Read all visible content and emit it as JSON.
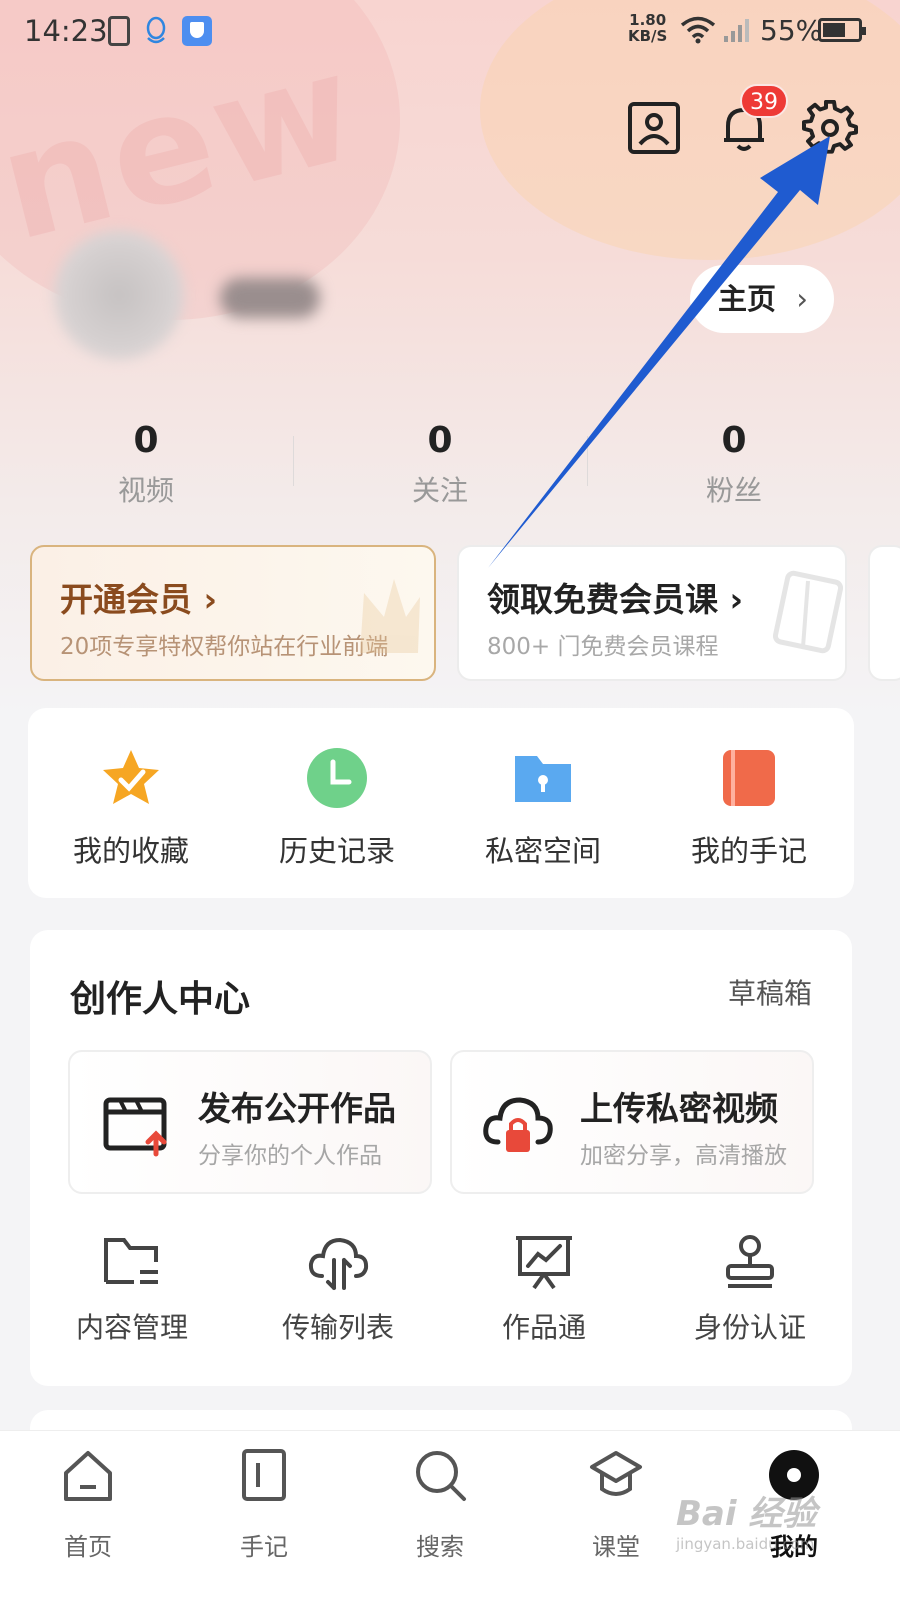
{
  "status_bar": {
    "time": "14:23",
    "net_speed_value": "1.80",
    "net_speed_unit": "KB/S",
    "battery": "55%"
  },
  "header": {
    "notification_count": "39"
  },
  "profile": {
    "homepage_label": "主页",
    "homepage_chevron": "›"
  },
  "stats": [
    {
      "value": "0",
      "label": "视频"
    },
    {
      "value": "0",
      "label": "关注"
    },
    {
      "value": "0",
      "label": "粉丝"
    }
  ],
  "promos": {
    "vip": {
      "title": "开通会员 ›",
      "subtitle": "20项专享特权帮你站在行业前端"
    },
    "course": {
      "title": "领取免费会员课 ›",
      "subtitle": "800+ 门免费会员课程"
    }
  },
  "quick_actions": [
    {
      "label": "我的收藏",
      "icon": "star-icon"
    },
    {
      "label": "历史记录",
      "icon": "clock-icon"
    },
    {
      "label": "私密空间",
      "icon": "private-folder-icon"
    },
    {
      "label": "我的手记",
      "icon": "notebook-icon"
    }
  ],
  "creator_center": {
    "title": "创作人中心",
    "drafts_label": "草稿箱",
    "publish": {
      "title": "发布公开作品",
      "subtitle": "分享你的个人作品"
    },
    "upload": {
      "title": "上传私密视频",
      "subtitle": "加密分享，高清播放"
    },
    "tools": [
      {
        "label": "内容管理",
        "icon": "folder-manage-icon"
      },
      {
        "label": "传输列表",
        "icon": "cloud-transfer-icon"
      },
      {
        "label": "作品通",
        "icon": "presentation-chart-icon"
      },
      {
        "label": "身份认证",
        "icon": "stamp-icon"
      }
    ]
  },
  "bottom_nav": [
    {
      "label": "首页",
      "icon": "home-icon"
    },
    {
      "label": "手记",
      "icon": "notes-icon"
    },
    {
      "label": "搜索",
      "icon": "search-icon"
    },
    {
      "label": "课堂",
      "icon": "classroom-icon"
    },
    {
      "label": "我的",
      "icon": "profile-dot-icon",
      "active": true
    }
  ],
  "watermark": {
    "line1": "Bai 经验",
    "line2": "jingyan.baidu.com"
  },
  "colors": {
    "accent_red": "#ee3a36",
    "vip_brown": "#8a4b1e",
    "annotation_arrow": "#1f5bd0"
  }
}
